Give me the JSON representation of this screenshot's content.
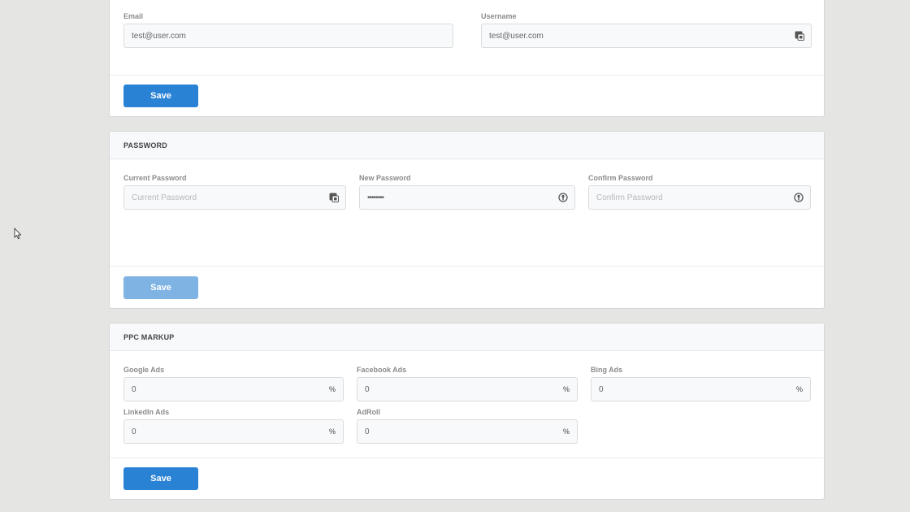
{
  "account": {
    "email": {
      "label": "Email",
      "value": "test@user.com"
    },
    "username": {
      "label": "Username",
      "value": "test@user.com"
    },
    "save_label": "Save"
  },
  "password": {
    "title": "PASSWORD",
    "current": {
      "label": "Current Password",
      "placeholder": "Current Password"
    },
    "new": {
      "label": "New Password",
      "value": "••••••••"
    },
    "confirm": {
      "label": "Confirm Password",
      "placeholder": "Confirm Password"
    },
    "save_label": "Save"
  },
  "ppc": {
    "title": "PPC MARKUP",
    "fields": [
      {
        "label": "Google Ads",
        "value": "0",
        "suffix": "%"
      },
      {
        "label": "Facebook Ads",
        "value": "0",
        "suffix": "%"
      },
      {
        "label": "Bing Ads",
        "value": "0",
        "suffix": "%"
      },
      {
        "label": "LinkedIn Ads",
        "value": "0",
        "suffix": "%"
      },
      {
        "label": "AdRoll",
        "value": "0",
        "suffix": "%"
      }
    ],
    "save_label": "Save"
  },
  "colors": {
    "primary": "#2a82d4",
    "primary_disabled": "#7fb3e3",
    "page_bg": "#e5e5e3"
  },
  "icons": [
    "password-manager-icon",
    "key-icon",
    "mouse-cursor-icon"
  ]
}
